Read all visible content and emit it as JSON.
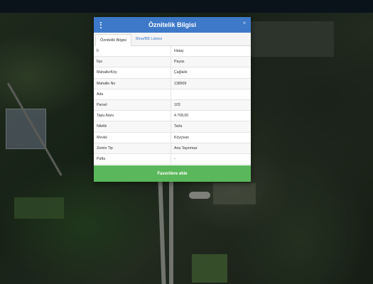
{
  "panel": {
    "title": "Öznitelik Bilgisi",
    "menu_icon": "kebab-menu-icon",
    "close_icon": "close-icon",
    "tabs": [
      {
        "label": "Öznitelik Bilgisi",
        "active": true
      },
      {
        "label": "Bina/BB Listesi",
        "active": false
      }
    ],
    "rows": [
      {
        "key": "İl",
        "value": "Hatay"
      },
      {
        "key": "İlçe",
        "value": "Payas"
      },
      {
        "key": "Mahalle/Köy",
        "value": "Çağlalık"
      },
      {
        "key": "Mahalle No",
        "value": "138509"
      },
      {
        "key": "Ada",
        "value": ""
      },
      {
        "key": "Parsel",
        "value": "103"
      },
      {
        "key": "Tapu Alanı",
        "value": "4.708,00"
      },
      {
        "key": "Nitelik",
        "value": "Tarla"
      },
      {
        "key": "Mevkii",
        "value": "Köyçivarı"
      },
      {
        "key": "Zemin Tip",
        "value": "Ana Taşınmaz"
      },
      {
        "key": "Pafta",
        "value": "-"
      }
    ],
    "favorite_button": "Favorilere ekle"
  },
  "colors": {
    "header": "#3d79c8",
    "favorite_button": "#5bb75b"
  }
}
